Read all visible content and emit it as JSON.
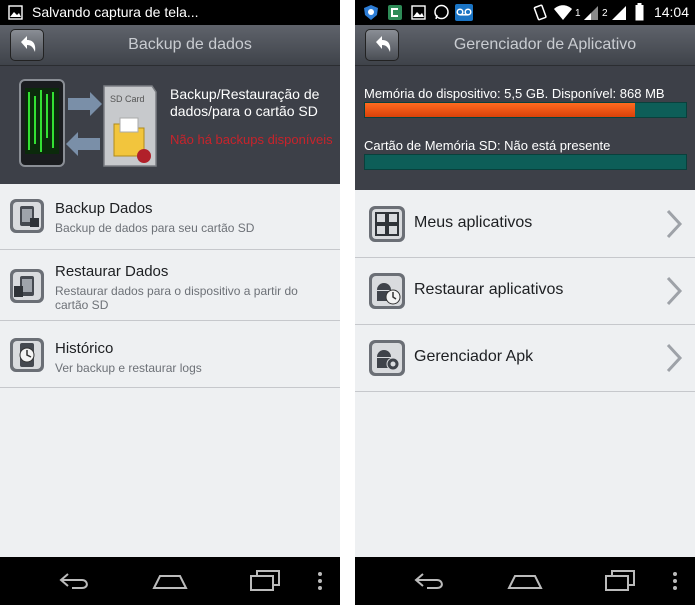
{
  "left": {
    "status_text": "Salvando captura de tela...",
    "title": "Backup de dados",
    "banner": {
      "title": "Backup/Restauração de dados/para o cartão SD",
      "warning": "Não há backups disponíveis",
      "sd_label": "SD Card"
    },
    "items": [
      {
        "title": "Backup Dados",
        "subtitle": "Backup de dados para seu cartão SD"
      },
      {
        "title": "Restaurar Dados",
        "subtitle": "Restaurar dados para o dispositivo a partir do cartão SD"
      },
      {
        "title": "Histórico",
        "subtitle": "Ver backup e restaurar logs"
      }
    ]
  },
  "right": {
    "clock": "14:04",
    "title": "Gerenciador de Aplicativo",
    "device_memory": "Memória do dispositivo: 5,5 GB. Disponível: 868 MB",
    "device_memory_used_fraction": 0.84,
    "sd_card": "Cartão de Memória SD: Não está presente",
    "sd_card_used_fraction": 0,
    "signal_labels": [
      "1",
      "2"
    ],
    "items": [
      {
        "title": "Meus aplicativos"
      },
      {
        "title": "Restaurar aplicativos"
      },
      {
        "title": "Gerenciador Apk"
      }
    ]
  }
}
